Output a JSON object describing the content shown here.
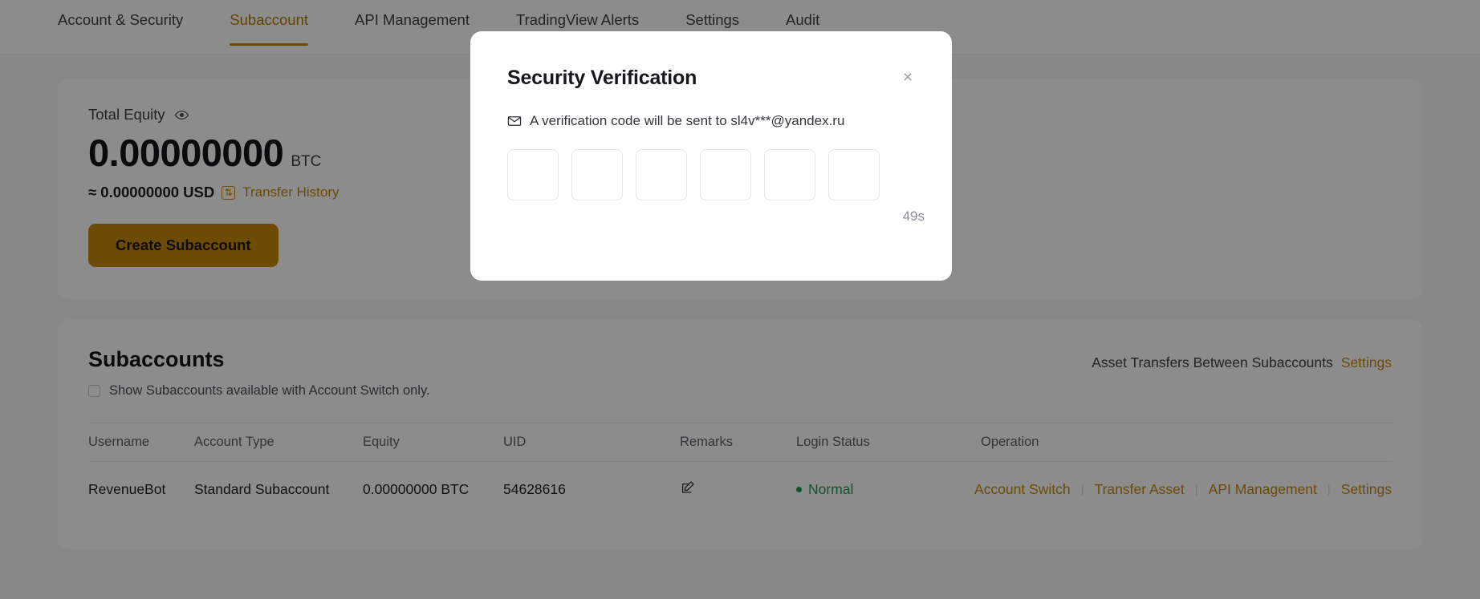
{
  "tabs": [
    {
      "label": "Account & Security",
      "active": false
    },
    {
      "label": "Subaccount",
      "active": true
    },
    {
      "label": "API Management",
      "active": false
    },
    {
      "label": "TradingView Alerts",
      "active": false
    },
    {
      "label": "Settings",
      "active": false
    },
    {
      "label": "Audit",
      "active": false
    }
  ],
  "equity": {
    "label": "Total Equity",
    "value": "0.00000000",
    "unit": "BTC",
    "usd": "≈ 0.00000000 USD",
    "transfer_history_label": "Transfer History",
    "create_button_label": "Create Subaccount"
  },
  "subaccounts": {
    "title": "Subaccounts",
    "checkbox_label": "Show Subaccounts available with Account Switch only.",
    "asset_transfer_text": "Asset Transfers Between Subaccounts",
    "asset_transfer_settings": "Settings",
    "columns": [
      "Username",
      "Account Type",
      "Equity",
      "UID",
      "Remarks",
      "Login Status",
      "Operation"
    ],
    "rows": [
      {
        "username": "RevenueBot",
        "account_type": "Standard Subaccount",
        "equity": "0.00000000 BTC",
        "uid": "54628616",
        "login_status": "Normal",
        "operations": [
          "Account Switch",
          "Transfer Asset",
          "API Management",
          "Settings"
        ]
      }
    ]
  },
  "modal": {
    "title": "Security Verification",
    "message": "A verification code will be sent to sl4v***@yandex.ru",
    "code_values": [
      "",
      "",
      "",
      "",
      "",
      ""
    ],
    "timer": "49s",
    "close_label": "×"
  },
  "colors": {
    "accent": "#c8890a",
    "status_normal": "#1f9d55"
  }
}
